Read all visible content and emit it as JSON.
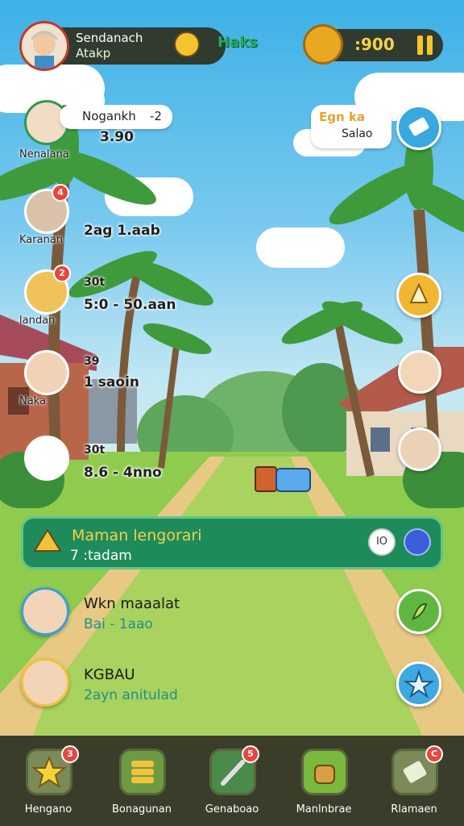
{
  "header": {
    "profile_name": "Sendanach",
    "profile_sub": "Atakp",
    "tag_link": "Haks",
    "currency_amount": ":900"
  },
  "players": [
    {
      "name": "Nenalana",
      "card_label": "Nogankh",
      "card_value": "-2",
      "value": "3.90",
      "badge": ""
    },
    {
      "name": "Karanan",
      "value": "2ag   1.aab",
      "badge": "4"
    },
    {
      "name": "landan",
      "top_value": "30t",
      "value": "5:0 - 50.aan",
      "badge": "2"
    },
    {
      "name": "Naka",
      "top_value": "39",
      "value": "1 saoin",
      "badge": ""
    },
    {
      "name": "",
      "top_value": "30t",
      "value": "8.6 - 4nno",
      "badge": ""
    }
  ],
  "speech": {
    "line1": "Egn ka",
    "line2": "Salao"
  },
  "quest": {
    "title": "Maman lengorari",
    "subtitle": "7 :tadam",
    "badge_label": "IO"
  },
  "rows": [
    {
      "name": "Wkn maaalat",
      "sub": "Bai - 1aao"
    },
    {
      "name": "KGBAU",
      "sub": "2ayn anitulad"
    }
  ],
  "bottom_nav": [
    {
      "label": "Hengano",
      "badge": "3",
      "icon": "star-icon"
    },
    {
      "label": "Bonagunan",
      "badge": "",
      "icon": "coins-icon"
    },
    {
      "label": "Genaboao",
      "badge": "5",
      "icon": "tools-icon"
    },
    {
      "label": "Manlnbrae",
      "badge": "",
      "icon": "bag-icon"
    },
    {
      "label": "Rlamaen",
      "badge": "C",
      "icon": "note-icon"
    }
  ],
  "colors": {
    "quest_bg": "#1e8c5a",
    "gold": "#f5d04a",
    "nav_bg": "#3a3d2a",
    "badge": "#e8463d"
  }
}
